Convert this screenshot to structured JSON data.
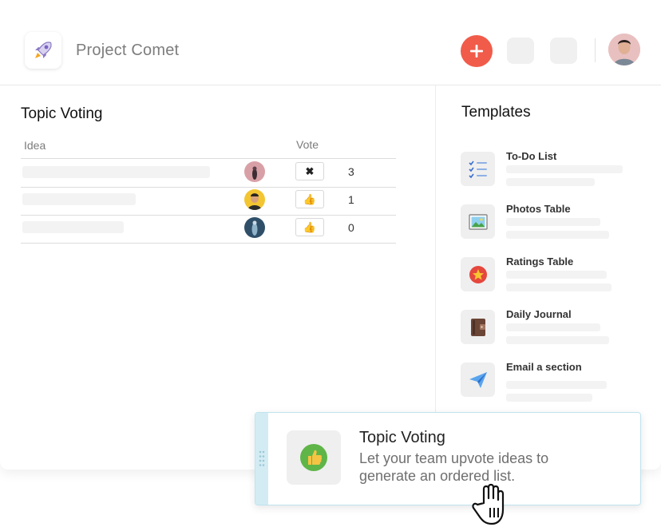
{
  "app": {
    "title": "Project Comet"
  },
  "header": {
    "add_button_icon": "plus-icon",
    "add_color": "#f15b4a"
  },
  "topic_voting": {
    "title": "Topic Voting",
    "columns": {
      "idea": "Idea",
      "vote": "Vote"
    },
    "rows": [
      {
        "vote_icon": "✖",
        "count": "3"
      },
      {
        "vote_icon": "👍",
        "count": "1"
      },
      {
        "vote_icon": "👍",
        "count": "0"
      }
    ]
  },
  "templates": {
    "title": "Templates",
    "items": [
      {
        "name": "To-Do List",
        "icon": "checklist-icon"
      },
      {
        "name": "Photos Table",
        "icon": "picture-icon"
      },
      {
        "name": "Ratings Table",
        "icon": "star-icon"
      },
      {
        "name": "Daily Journal",
        "icon": "journal-icon"
      },
      {
        "name": "Email a section",
        "icon": "paper-plane-icon"
      }
    ]
  },
  "drag_card": {
    "title": "Topic Voting",
    "description": "Let your team upvote ideas to generate an ordered list.",
    "icon": "thumbs-up-icon"
  }
}
